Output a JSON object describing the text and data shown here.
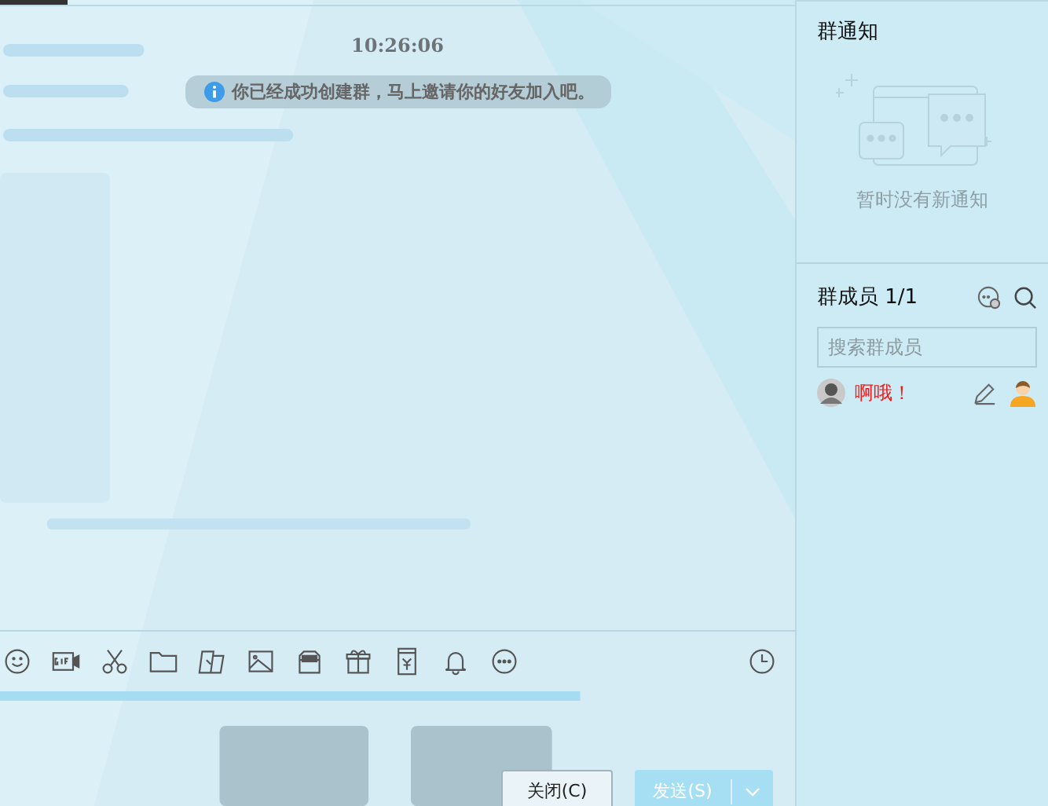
{
  "chat": {
    "timestamp": "10:26:06",
    "system_notice": "你已经成功创建群，马上邀请你的好友加入吧。"
  },
  "actions": {
    "close_button": {
      "label": "关闭(C)",
      "disabled": false
    },
    "send_button": {
      "label": "发送(S)",
      "disabled": true
    }
  },
  "sidebar": {
    "notice": {
      "title": "群通知",
      "empty_text": "暂时没有新通知"
    },
    "members": {
      "title": "群成员",
      "count": "1/1",
      "search": {
        "placeholder": "搜索群成员"
      },
      "list": [
        {
          "name": "啊哦！",
          "is_owner": true
        }
      ]
    }
  }
}
